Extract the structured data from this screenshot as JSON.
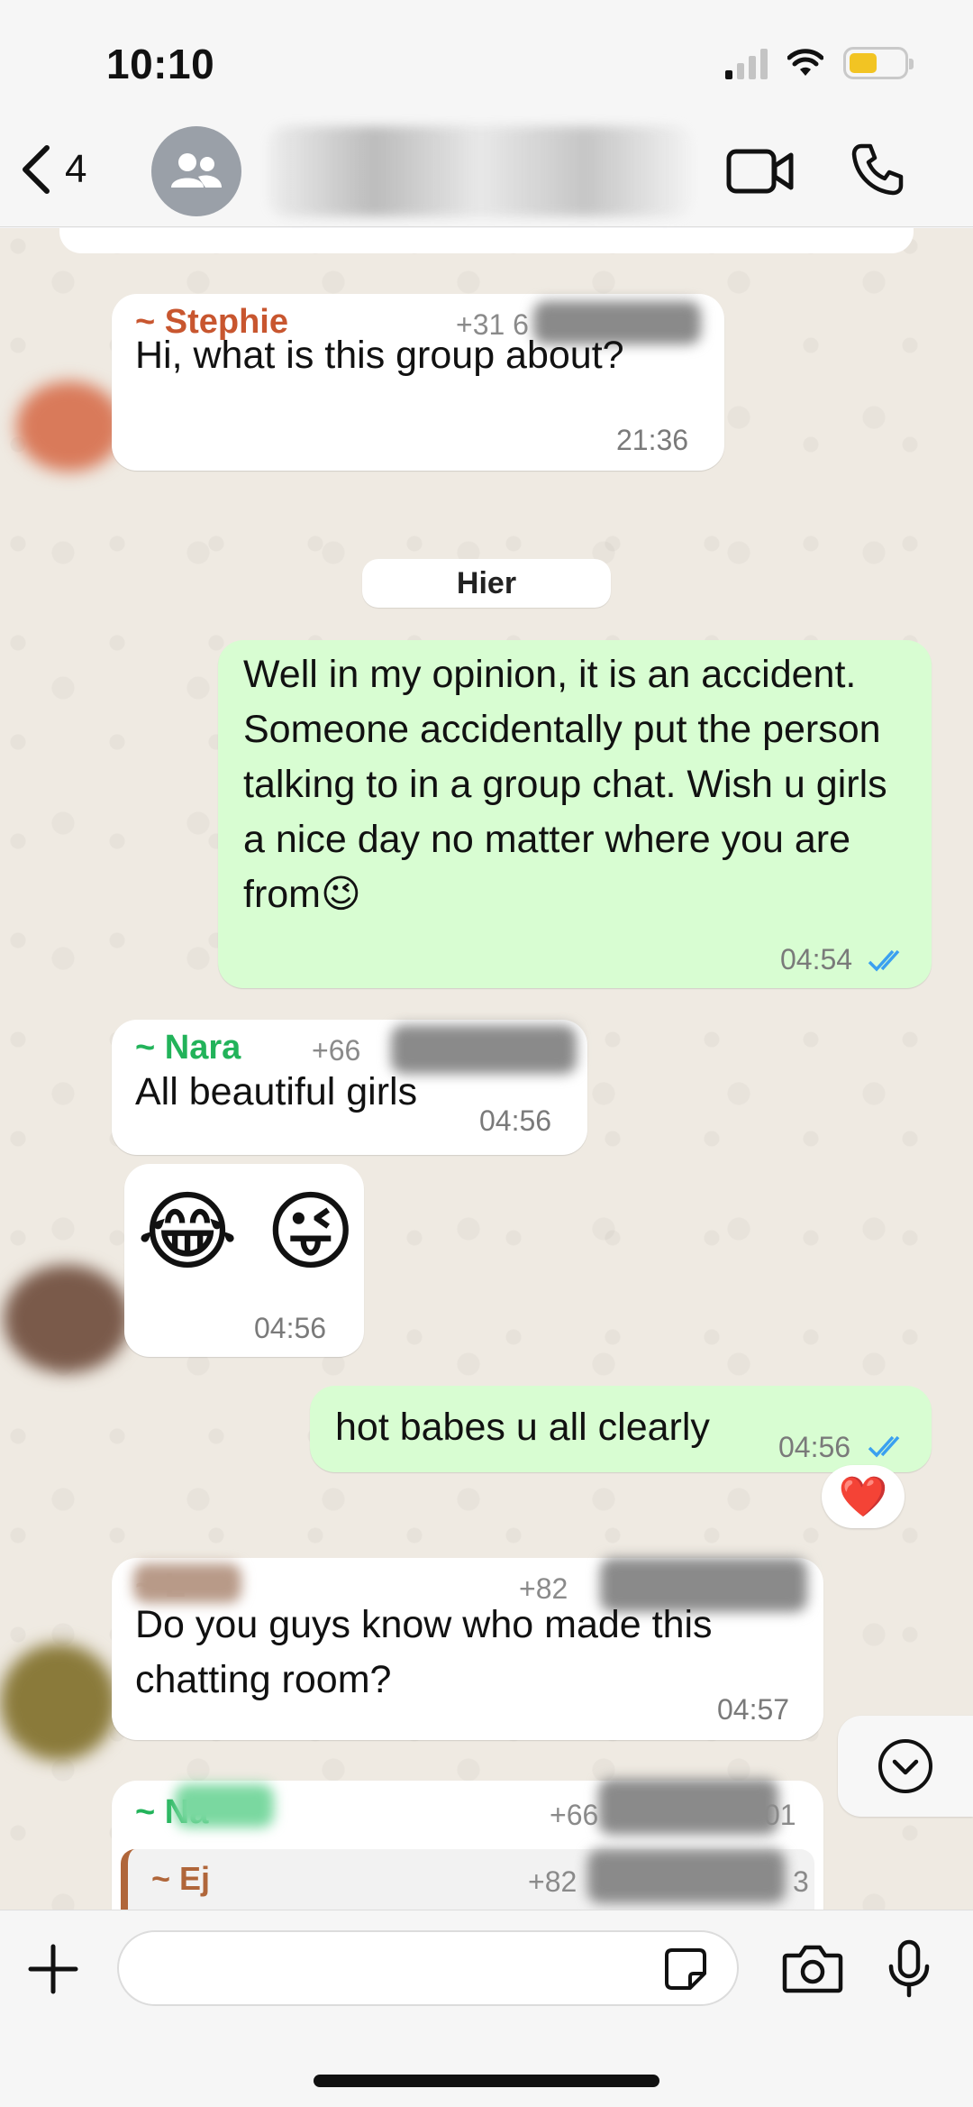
{
  "status_bar": {
    "time": "10:10"
  },
  "header": {
    "back_count": "4"
  },
  "chat": {
    "messages": [
      {
        "sender": "~ Stephie",
        "sender_color": "#c8562f",
        "phone": "+31 6",
        "text": "Hi, what is this group about?",
        "time": "21:36"
      },
      {
        "day_label": "Hier"
      },
      {
        "text": "Well in my opinion, it is an accident. Someone accidentally put the person talking to in a group chat. Wish u girls a nice day no matter where you are from😉",
        "time": "04:54",
        "status": "read"
      },
      {
        "sender": "~ Nara",
        "sender_color": "#22b35a",
        "phone": "+66",
        "text": "All beautiful girls",
        "time": "04:56"
      },
      {
        "text": "😂 😜",
        "time": "04:56"
      },
      {
        "text": "hot babes u all clearly",
        "time": "04:56",
        "status": "read",
        "reaction": "❤️"
      },
      {
        "sender": "~ L",
        "phone": "+82",
        "text": "Do you guys know who made this chatting room?",
        "time": "04:57"
      },
      {
        "sender": "~ Na",
        "sender_color": "#22b35a",
        "phone": "+66",
        "phone_tail": "01",
        "quote": {
          "sender": "~ Ej",
          "sender_color": "#b0663a",
          "phone": "+82",
          "phone_tail": "3"
        }
      }
    ]
  },
  "composer": {
    "placeholder": ""
  },
  "colors": {
    "outgoing": "#d8fdd2",
    "incoming": "#ffffff",
    "read_ticks": "#3aa0f0",
    "wallpaper": "#efeae2"
  }
}
